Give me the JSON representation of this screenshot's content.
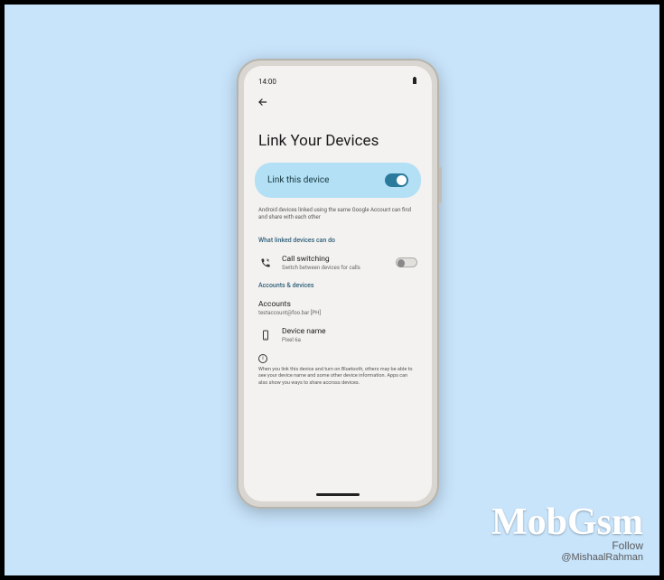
{
  "status": {
    "time": "14:00"
  },
  "page": {
    "title": "Link Your Devices",
    "hero_label": "Link this device",
    "hero_description": "Android devices linked using the same Google Account can find and share with each other"
  },
  "sections": {
    "capabilities": {
      "header": "What linked devices can do",
      "call_switching": {
        "title": "Call switching",
        "subtitle": "Switch between devices for calls"
      }
    },
    "accounts": {
      "header": "Accounts & devices",
      "accounts_row": {
        "title": "Accounts",
        "subtitle": "testaccount@foo.bar [PH]"
      },
      "device_row": {
        "title": "Device name",
        "subtitle": "Pixel 6a"
      }
    }
  },
  "footer": {
    "text": "When you link this device and turn on Bluetooth, others may be able to see your device name and some other device information. Apps can also show you ways to share accross devices."
  },
  "watermark": {
    "brand": "MobGsm",
    "follow": "Follow",
    "handle": "@MishaalRahman"
  }
}
